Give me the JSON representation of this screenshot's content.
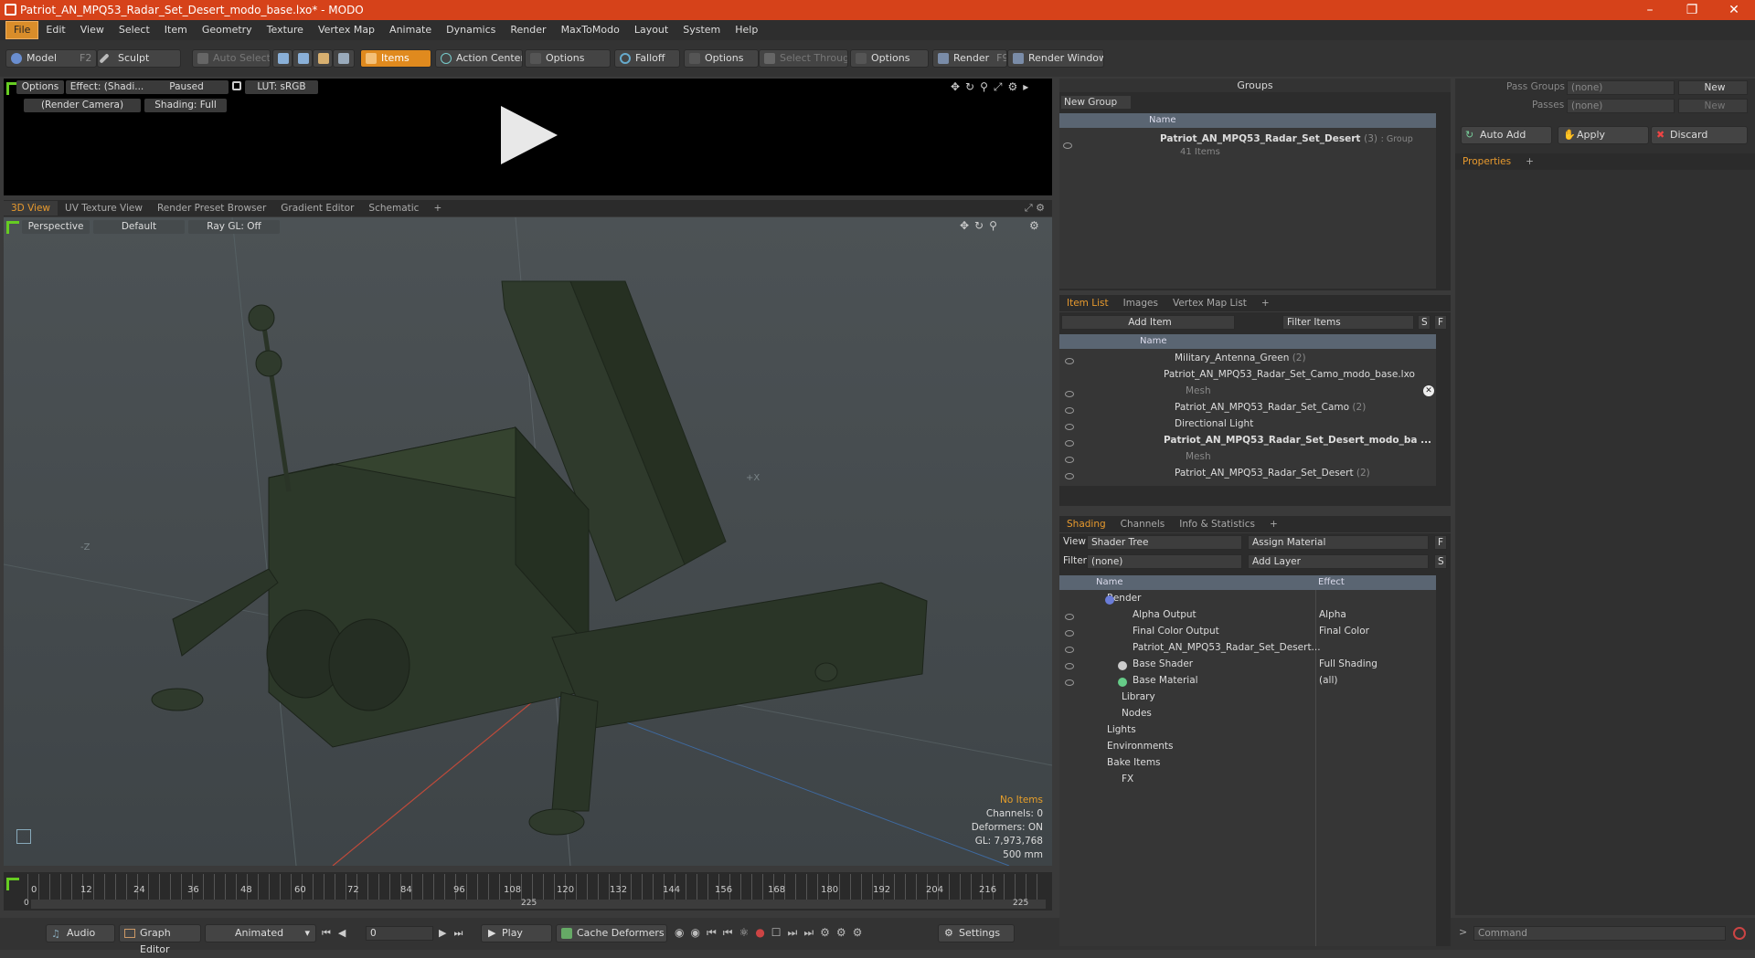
{
  "window": {
    "title": "Patriot_AN_MPQ53_Radar_Set_Desert_modo_base.lxo* - MODO"
  },
  "menu": [
    "File",
    "Edit",
    "View",
    "Select",
    "Item",
    "Geometry",
    "Texture",
    "Vertex Map",
    "Animate",
    "Dynamics",
    "Render",
    "MaxToModo",
    "Layout",
    "System",
    "Help"
  ],
  "toolbar": {
    "model": "Model",
    "model_key": "F2",
    "sculpt": "Sculpt",
    "auto_select": "Auto Select",
    "items": "Items",
    "action_center": "Action Center",
    "options1": "Options",
    "falloff": "Falloff",
    "options2": "Options",
    "select_through": "Select Through",
    "options3": "Options",
    "render": "Render",
    "render_key": "F9",
    "render_window": "Render Window"
  },
  "preview": {
    "options": "Options",
    "effect": "Effect: (Shadi...",
    "paused": "Paused",
    "lut": "LUT: sRGB",
    "camera": "(Render Camera)",
    "shading": "Shading: Full"
  },
  "view_tabs": [
    "3D View",
    "UV Texture View",
    "Render Preset Browser",
    "Gradient Editor",
    "Schematic"
  ],
  "viewport": {
    "perspective": "Perspective",
    "default": "Default",
    "raygl": "Ray GL: Off",
    "label_x": "+X",
    "label_z": "-Z"
  },
  "stats": {
    "no_items": "No Items",
    "channels": "Channels: 0",
    "deformers": "Deformers: ON",
    "gl": "GL: 7,973,768",
    "size": "500 mm"
  },
  "timeline": {
    "ticks": [
      "0",
      "12",
      "24",
      "36",
      "48",
      "60",
      "72",
      "84",
      "96",
      "108",
      "120",
      "132",
      "144",
      "156",
      "168",
      "180",
      "192",
      "204",
      "216"
    ],
    "start": "0",
    "mid": "225",
    "end": "225"
  },
  "bottom": {
    "audio": "Audio",
    "graph_editor": "Graph Editor",
    "animated": "Animated",
    "frame": "0",
    "play": "Play",
    "cache": "Cache Deformers",
    "settings": "Settings",
    "command_placeholder": "Command"
  },
  "groups": {
    "title": "Groups",
    "new_group": "New Group",
    "col_name": "Name",
    "item_name": "Patriot_AN_MPQ53_Radar_Set_Desert",
    "item_count": "(3)",
    "item_type": ": Group",
    "item_sub": "41 Items"
  },
  "itemlist": {
    "tabs": [
      "Item List",
      "Images",
      "Vertex Map List"
    ],
    "add_item": "Add Item",
    "filter": "Filter Items",
    "s": "S",
    "f": "F",
    "col_name": "Name",
    "rows": [
      {
        "label": "Military_Antenna_Green",
        "count": "(2)"
      },
      {
        "label": "Patriot_AN_MPQ53_Radar_Set_Camo_modo_base.lxo",
        "count": ""
      },
      {
        "label": "Mesh",
        "count": ""
      },
      {
        "label": "Patriot_AN_MPQ53_Radar_Set_Camo",
        "count": "(2)"
      },
      {
        "label": "Directional Light",
        "count": ""
      },
      {
        "label": "Patriot_AN_MPQ53_Radar_Set_Desert_modo_ba ...",
        "count": ""
      },
      {
        "label": "Mesh",
        "count": ""
      },
      {
        "label": "Patriot_AN_MPQ53_Radar_Set_Desert",
        "count": "(2)"
      }
    ]
  },
  "shading": {
    "tabs": [
      "Shading",
      "Channels",
      "Info & Statistics"
    ],
    "view_label": "View",
    "view_value": "Shader Tree",
    "assign": "Assign Material",
    "f": "F",
    "filter_label": "Filter",
    "filter_value": "(none)",
    "add_layer": "Add Layer",
    "s": "S",
    "col_name": "Name",
    "col_effect": "Effect",
    "rows": [
      {
        "label": "Render",
        "effect": ""
      },
      {
        "label": "Alpha Output",
        "effect": "Alpha"
      },
      {
        "label": "Final Color Output",
        "effect": "Final Color"
      },
      {
        "label": "Patriot_AN_MPQ53_Radar_Set_Desert...",
        "effect": ""
      },
      {
        "label": "Base Shader",
        "effect": "Full Shading"
      },
      {
        "label": "Base Material",
        "effect": "(all)"
      },
      {
        "label": "Library",
        "effect": ""
      },
      {
        "label": "Nodes",
        "effect": ""
      },
      {
        "label": "Lights",
        "effect": ""
      },
      {
        "label": "Environments",
        "effect": ""
      },
      {
        "label": "Bake Items",
        "effect": ""
      },
      {
        "label": "FX",
        "effect": ""
      }
    ]
  },
  "right": {
    "pass_groups": "Pass Groups",
    "passes": "Passes",
    "none1": "(none)",
    "none2": "(none)",
    "new1": "New",
    "new2": "New",
    "auto_add": "Auto Add",
    "apply": "Apply",
    "discard": "Discard",
    "properties": "Properties"
  }
}
